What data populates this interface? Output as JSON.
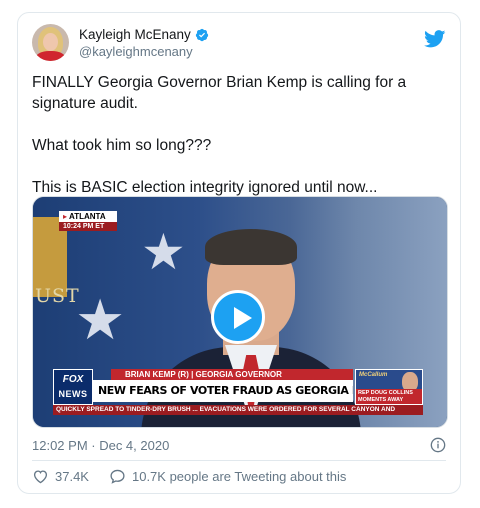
{
  "tweet": {
    "display_name": "Kayleigh McEnany",
    "handle": "@kayleighmcenany",
    "text_lines": [
      "FINALLY Georgia Governor Brian Kemp is calling for a signature audit.",
      "What took him so long???",
      "This is BASIC election integrity ignored until now..."
    ],
    "timestamp": "12:02 PM · Dec 4, 2020",
    "likes": "37.4K",
    "retweets_text": "10.7K people are Tweeting about this"
  },
  "video": {
    "location": "ATLANTA",
    "time": "10:24 PM ET",
    "flag_text": "UST",
    "name_chyron": "BRIAN KEMP (R) | GEORGIA GOVERNOR",
    "logo_top": "FOX",
    "logo_bottom": "NEWS",
    "headline": "NEW FEARS OF VOTER FRAUD AS GEORGIA RUNOFF NEARS",
    "promo_logo": "McCallum",
    "promo_text": "REP DOUG COLLINS MOMENTS AWAY",
    "ticker": "QUICKLY SPREAD TO TINDER-DRY BRUSH ... EVACUATIONS WERE ORDERED FOR SEVERAL CANYON AND"
  },
  "colors": {
    "twitter_blue": "#1da1f2",
    "secondary_text": "#657786",
    "fox_red": "#c1272d"
  },
  "icons": [
    "verified-badge-icon",
    "twitter-bird-icon",
    "play-icon",
    "info-icon",
    "heart-icon",
    "comment-icon"
  ]
}
